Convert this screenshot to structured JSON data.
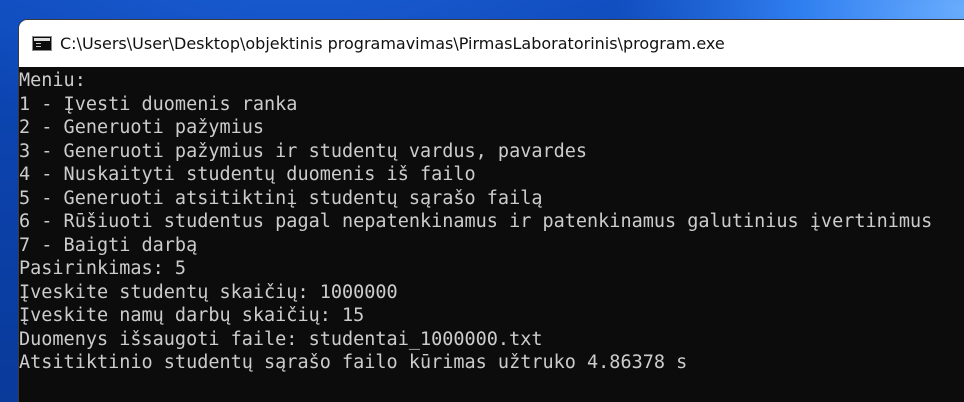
{
  "window": {
    "title": "C:\\Users\\User\\Desktop\\objektinis programavimas\\PirmasLaboratorinis\\program.exe",
    "icon": "console-app-icon"
  },
  "console": {
    "lines": [
      "Meniu:",
      "1 - Įvesti duomenis ranka",
      "2 - Generuoti pažymius",
      "3 - Generuoti pažymius ir studentų vardus, pavardes",
      "4 - Nuskaityti studentų duomenis iš failo",
      "5 - Generuoti atsitiktinį studentų sąrašo failą",
      "6 - Rūšiuoti studentus pagal nepatenkinamus ir patenkinamus galutinius įvertinimus",
      "7 - Baigti darbą",
      "Pasirinkimas: 5",
      "Įveskite studentų skaičių: 1000000",
      "Įveskite namų darbų skaičių: 15",
      "Duomenys išsaugoti faile: studentai_1000000.txt",
      "Atsitiktinio studentų sąrašo failo kūrimas užtruko 4.86378 s"
    ]
  },
  "colors": {
    "console_background": "#0c0c0c",
    "console_text": "#cccccc",
    "titlebar_background": "#ffffff"
  }
}
